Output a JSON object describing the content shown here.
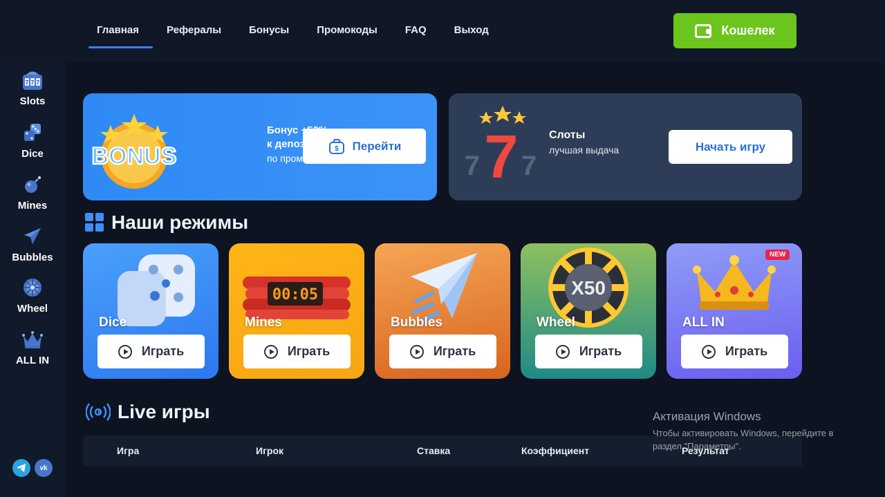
{
  "nav": {
    "items": [
      {
        "label": "Главная",
        "active": true
      },
      {
        "label": "Рефералы"
      },
      {
        "label": "Бонусы"
      },
      {
        "label": "Промокоды"
      },
      {
        "label": "FAQ"
      },
      {
        "label": "Выход"
      }
    ],
    "wallet_label": "Кошелек"
  },
  "sidebar": {
    "items": [
      {
        "label": "Slots",
        "icon": "slot-machine-icon"
      },
      {
        "label": "Dice",
        "icon": "dice-icon"
      },
      {
        "label": "Mines",
        "icon": "bomb-icon"
      },
      {
        "label": "Bubbles",
        "icon": "plane-icon"
      },
      {
        "label": "Wheel",
        "icon": "wheel-icon"
      },
      {
        "label": "ALL IN",
        "icon": "crown-icon"
      }
    ],
    "social": [
      {
        "name": "telegram",
        "icon": "telegram-icon"
      },
      {
        "name": "vk",
        "icon": "vk-icon"
      }
    ]
  },
  "banners": {
    "bonus": {
      "art_text": "BONUS",
      "line1": "Бонус +50%",
      "line2": "к депозиту!",
      "line3": "по промокоду DEP50",
      "button": "Перейти"
    },
    "slots": {
      "title": "Слоты",
      "subtitle": "лучшая выдача",
      "button": "Начать игру"
    }
  },
  "modes": {
    "title": "Наши режимы",
    "cards": [
      {
        "name": "Dice",
        "button": "Играть"
      },
      {
        "name": "Mines",
        "button": "Играть",
        "timer": "00:05"
      },
      {
        "name": "Bubbles",
        "button": "Играть"
      },
      {
        "name": "Wheel",
        "button": "Играть",
        "multiplier": "X50"
      },
      {
        "name": "ALL IN",
        "button": "Играть",
        "badge": "NEW"
      }
    ]
  },
  "live": {
    "title": "Live игры",
    "columns": [
      "Игра",
      "Игрок",
      "Ставка",
      "Коэффициент",
      "Результат"
    ]
  },
  "overlay": {
    "title": "Активация Windows",
    "text": "Чтобы активировать Windows, перейдите в раздел \"Параметры\"."
  },
  "colors": {
    "background": "#0d1320",
    "accent_blue": "#3d7ff5",
    "wallet_green": "#6cc51c",
    "new_badge": "#e8244a"
  }
}
